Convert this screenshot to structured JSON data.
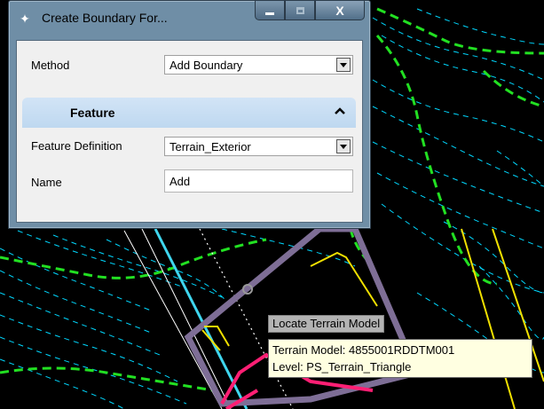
{
  "window": {
    "title": "Create Boundary For...",
    "icon": "microstation-icon",
    "buttons": {
      "minimize": "minimize-icon",
      "maximize": "maximize-icon",
      "close_label": "X"
    }
  },
  "form": {
    "method_label": "Method",
    "method_value": "Add Boundary",
    "section_title": "Feature",
    "feature_definition_label": "Feature Definition",
    "feature_definition_value": "Terrain_Exterior",
    "name_label": "Name",
    "name_value": "Add"
  },
  "tooltips": {
    "prompt": "Locate Terrain Model",
    "terrain_model": "Terrain Model: 4855001RDDTM001",
    "level": "Level: PS_Terrain_Triangle"
  },
  "colors": {
    "background": "#000000",
    "contour_dash": "#00d8ff",
    "green_dash": "#22e022",
    "boundary_purple": "#7e6e96",
    "cyan_line": "#3fd6ee",
    "yellow_line": "#f0e000",
    "magenta_line": "#ff1f74"
  }
}
